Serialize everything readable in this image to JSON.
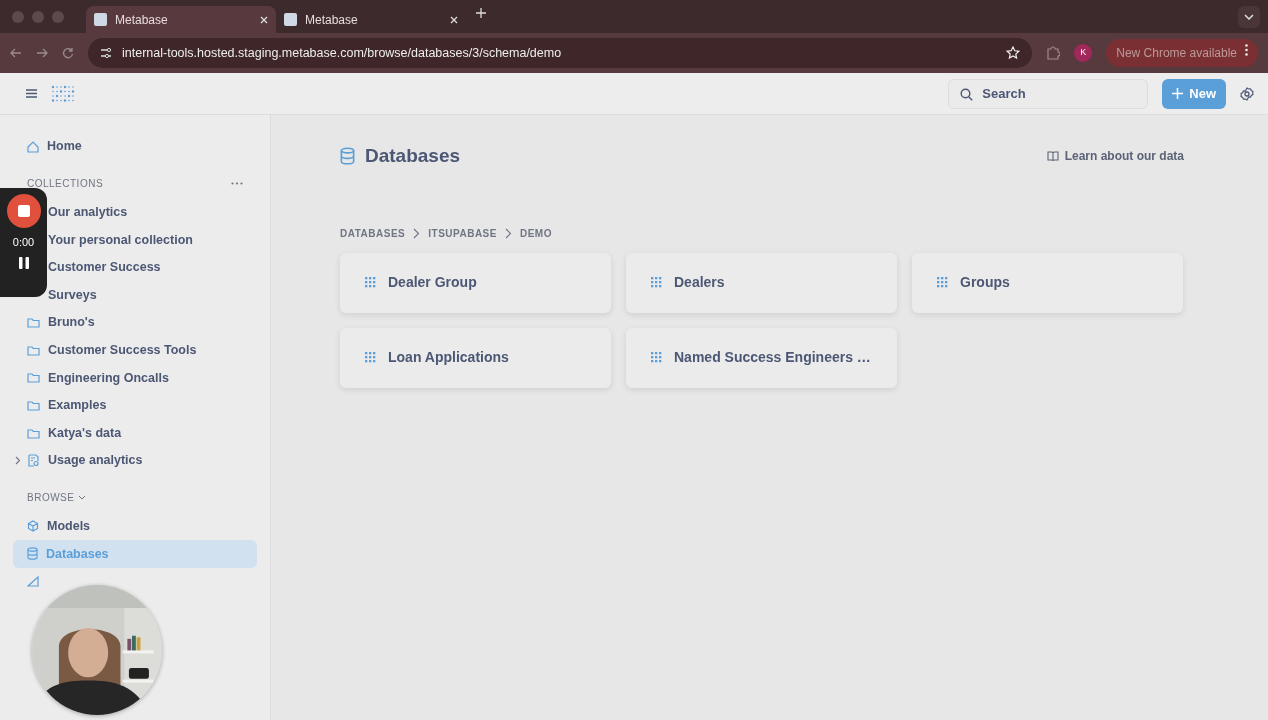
{
  "browser": {
    "tabs": [
      {
        "title": "Metabase",
        "selected": true
      },
      {
        "title": "Metabase",
        "selected": false
      }
    ],
    "url": "internal-tools.hosted.staging.metabase.com/browse/databases/3/schema/demo",
    "avatar": "K",
    "update_notice": "New Chrome available"
  },
  "header": {
    "search": {
      "placeholder": "Search"
    },
    "new_button": "New"
  },
  "sidebar": {
    "home": "Home",
    "collections_heading": "COLLECTIONS",
    "collections": [
      {
        "label": "Our analytics",
        "kind": "covered"
      },
      {
        "label": "Your personal collection",
        "kind": "covered"
      },
      {
        "label": "Customer Success",
        "kind": "covered"
      },
      {
        "label": "Surveys",
        "kind": "covered"
      },
      {
        "label": "Bruno's",
        "kind": "folder",
        "expandable": false
      },
      {
        "label": "Customer Success Tools",
        "kind": "folder",
        "expandable": false
      },
      {
        "label": "Engineering Oncalls",
        "kind": "folder",
        "expandable": false
      },
      {
        "label": "Examples",
        "kind": "folder",
        "expandable": false
      },
      {
        "label": "Katya's data",
        "kind": "folder",
        "expandable": false
      },
      {
        "label": "Usage analytics",
        "kind": "analytics",
        "expandable": true
      }
    ],
    "browse_heading": "BROWSE",
    "browse_items": [
      {
        "label": "Models",
        "kind": "model",
        "selected": false
      },
      {
        "label": "Databases",
        "kind": "database",
        "selected": true
      },
      {
        "kind": "metric",
        "selected": false
      }
    ]
  },
  "recorder": {
    "time": "0:00"
  },
  "main": {
    "title": "Databases",
    "learn_link": "Learn about our data",
    "breadcrumbs": [
      "DATABASES",
      "ITSUPABASE",
      "DEMO"
    ],
    "tables": [
      "Dealer Group",
      "Dealers",
      "Groups",
      "Loan Applications",
      "Named Success Engineers …"
    ]
  }
}
